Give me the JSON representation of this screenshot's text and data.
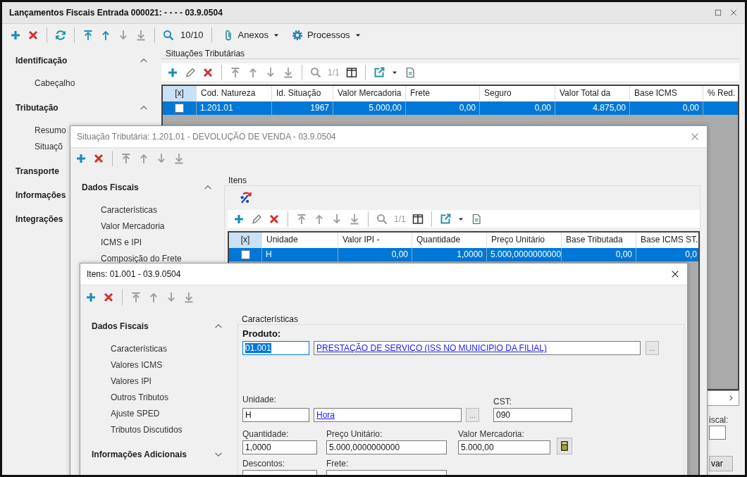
{
  "main_window": {
    "title": "Lançamentos Fiscais Entrada 000021: - - - - 03.9.0504",
    "toolbar": {
      "counter": "10/10",
      "menus": [
        {
          "label": "Anexos",
          "kind": "attachments"
        },
        {
          "label": "Processos",
          "kind": "processes"
        }
      ]
    },
    "sidebar": [
      {
        "label": "Identificação",
        "expanded": true,
        "children": [
          {
            "label": "Cabeçalho"
          }
        ]
      },
      {
        "label": "Tributação",
        "expanded": true,
        "children": [
          {
            "label": "Resumo"
          },
          {
            "label": "Situaçõ"
          }
        ]
      },
      {
        "label": "Transporte"
      },
      {
        "label": "Informações"
      },
      {
        "label": "Integrações"
      }
    ],
    "group_title": "Situações Tributárias",
    "grid_counter": "1/1",
    "table": {
      "check_header": "[x]",
      "columns": [
        "Cod. Natureza",
        "Id. Situação",
        "Valor Mercadoria",
        "Frete",
        "Seguro",
        "Valor Total da",
        "Base ICMS",
        "% Red."
      ],
      "rows": [
        {
          "selected": true,
          "checked": false,
          "cells": [
            "1.201.01",
            "1967",
            "5.000,00",
            "0,00",
            "0,00",
            "4.875,00",
            "0,00",
            ""
          ]
        }
      ]
    },
    "side_field_label": "iscal:",
    "side_button": "var"
  },
  "tax_dialog": {
    "title": "Situação Tributária: 1.201.01 - DEVOLUÇÃO DE VENDA - 03.9.0504",
    "active": false,
    "sidebar": [
      {
        "label": "Dados Fiscais",
        "expanded": true,
        "children": [
          {
            "label": "Características"
          },
          {
            "label": "Valor Mercadoria"
          },
          {
            "label": "ICMS e IPI"
          },
          {
            "label": "Composição do Frete"
          }
        ]
      }
    ],
    "group_title": "Itens",
    "grid_counter": "1/1",
    "table": {
      "check_header": "[x]",
      "columns": [
        "Unidade",
        "Valor IPI -",
        "Quantidade",
        "Preço Unitário",
        "Base Tributada",
        "Base ICMS ST."
      ],
      "rows": [
        {
          "selected": true,
          "checked": false,
          "cells": [
            "H",
            "0,00",
            "1,0000",
            "5.000,0000000000",
            "0,00",
            "0,0"
          ]
        }
      ]
    }
  },
  "item_dialog": {
    "title": "Itens: 01.001 - 03.9.0504",
    "active": true,
    "sidebar": [
      {
        "label": "Dados Fiscais",
        "expanded": true,
        "children": [
          {
            "label": "Características"
          },
          {
            "label": "Valores ICMS"
          },
          {
            "label": "Valores IPI"
          },
          {
            "label": "Outros Tributos"
          },
          {
            "label": "Ajuste SPED"
          },
          {
            "label": "Tributos Discutidos"
          }
        ]
      },
      {
        "label": "Informações Adicionais",
        "expanded": false
      }
    ],
    "form": {
      "group_title": "Características",
      "product": {
        "label": "Produto:",
        "code": "01.001",
        "code_selected": true,
        "description": "PRESTAÇÃO DE SERVIÇO (ISS NO MUNICIPIO DA FILIAL)",
        "lookup": "..."
      },
      "unit": {
        "label": "Unidade:",
        "code": "H",
        "description": "Hora",
        "lookup": "..."
      },
      "cst": {
        "label": "CST:",
        "value": "090"
      },
      "quantity": {
        "label": "Quantidade:",
        "value": "1,0000"
      },
      "unit_price": {
        "label": "Preço Unitário:",
        "value": "5.000,0000000000"
      },
      "goods_value": {
        "label": "Valor Mercadoria:",
        "value": "5.000,00"
      },
      "discounts": {
        "label": "Descontos:"
      },
      "freight": {
        "label": "Frete:"
      }
    }
  }
}
